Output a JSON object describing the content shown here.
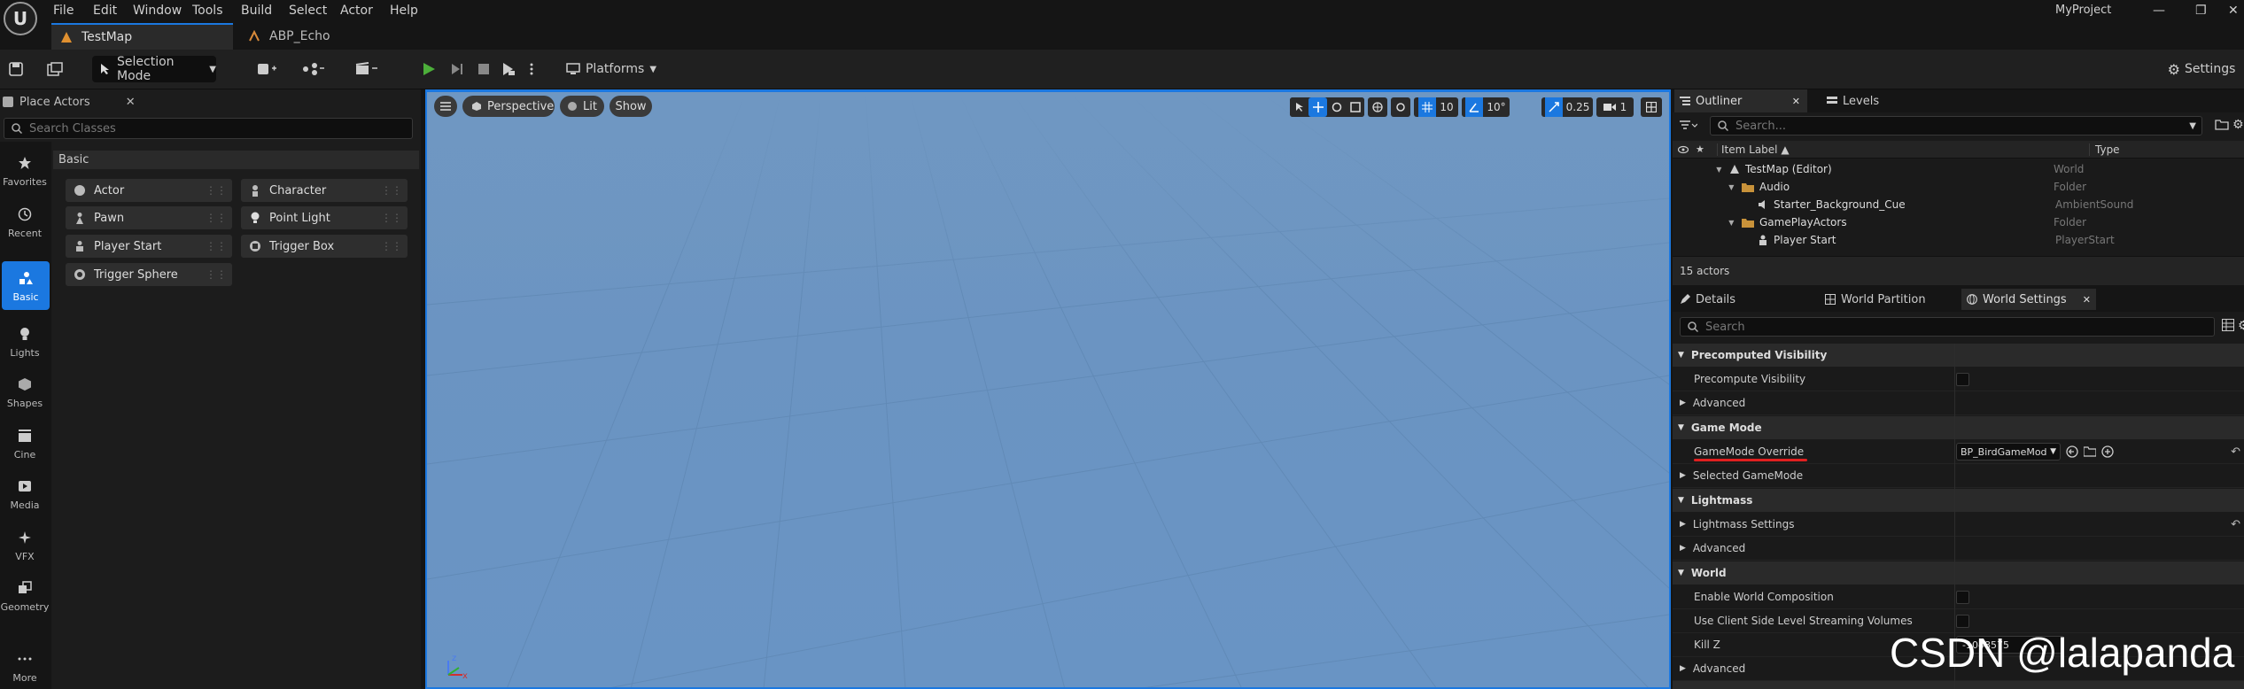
{
  "app": {
    "logo_text": "U",
    "project_name": "MyProject"
  },
  "window_controls": {
    "minimize": "—",
    "maximize": "❐",
    "close": "✕"
  },
  "menu": [
    "File",
    "Edit",
    "Window",
    "Tools",
    "Build",
    "Select",
    "Actor",
    "Help"
  ],
  "tabs": [
    {
      "label": "TestMap",
      "active": true
    },
    {
      "label": "ABP_Echo",
      "active": false
    }
  ],
  "toolbar": {
    "selection_mode": "Selection Mode",
    "platforms": "Platforms",
    "settings": "Settings"
  },
  "place_actors": {
    "title": "Place Actors",
    "search_placeholder": "Search Classes",
    "section": "Basic",
    "categories": [
      "Favorites",
      "Recent",
      "Basic",
      "Lights",
      "Shapes",
      "Cine",
      "Media",
      "VFX",
      "Geometry",
      "More"
    ],
    "active_category": "Basic",
    "items": [
      "Actor",
      "Character",
      "Pawn",
      "Point Light",
      "Player Start",
      "Trigger Box",
      "Trigger Sphere"
    ]
  },
  "viewport": {
    "view_mode": "Perspective",
    "lighting": "Lit",
    "show": "Show",
    "grid_snap": "10",
    "rotation_snap": "10°",
    "scale_snap": "0.25",
    "camera_speed": "1",
    "axis_labels": {
      "z": "z",
      "x": "x"
    }
  },
  "outliner": {
    "tabs": [
      "Outliner",
      "Levels"
    ],
    "search_placeholder": "Search...",
    "columns": [
      "Item Label ▲",
      "Type"
    ],
    "rows": [
      {
        "label": "TestMap (Editor)",
        "type": "World",
        "indent": 0
      },
      {
        "label": "Audio",
        "type": "Folder",
        "indent": 1
      },
      {
        "label": "Starter_Background_Cue",
        "type": "AmbientSound",
        "indent": 2
      },
      {
        "label": "GamePlayActors",
        "type": "Folder",
        "indent": 1
      },
      {
        "label": "Player Start",
        "type": "PlayerStart",
        "indent": 2
      }
    ],
    "actor_count": "15 actors"
  },
  "details": {
    "tabs": [
      "Details",
      "World Partition",
      "World Settings"
    ],
    "search_placeholder": "Search",
    "sections": [
      {
        "title": "Precomputed Visibility",
        "props": [
          {
            "label": "Precompute Visibility",
            "kind": "checkbox"
          },
          {
            "label": "Advanced",
            "kind": "expander"
          }
        ]
      },
      {
        "title": "Game Mode",
        "props": [
          {
            "label": "GameMode Override",
            "kind": "dropdown",
            "value": "BP_BirdGameMod",
            "underline": true,
            "reset": true
          },
          {
            "label": "Selected GameMode",
            "kind": "expander"
          }
        ]
      },
      {
        "title": "Lightmass",
        "props": [
          {
            "label": "Lightmass Settings",
            "kind": "expander",
            "reset": true
          },
          {
            "label": "Advanced",
            "kind": "expander"
          }
        ]
      },
      {
        "title": "World",
        "props": [
          {
            "label": "Enable World Composition",
            "kind": "checkbox"
          },
          {
            "label": "Use Client Side Level Streaming Volumes",
            "kind": "checkbox"
          },
          {
            "label": "Kill Z",
            "kind": "number",
            "value": "-1048575"
          },
          {
            "label": "Advanced",
            "kind": "expander"
          }
        ]
      }
    ]
  },
  "watermark": "CSDN @lalapanda",
  "colors": {
    "accent": "#1b78e0",
    "underline": "#e02020",
    "play": "#4caf3a",
    "folder": "#c8923a"
  }
}
